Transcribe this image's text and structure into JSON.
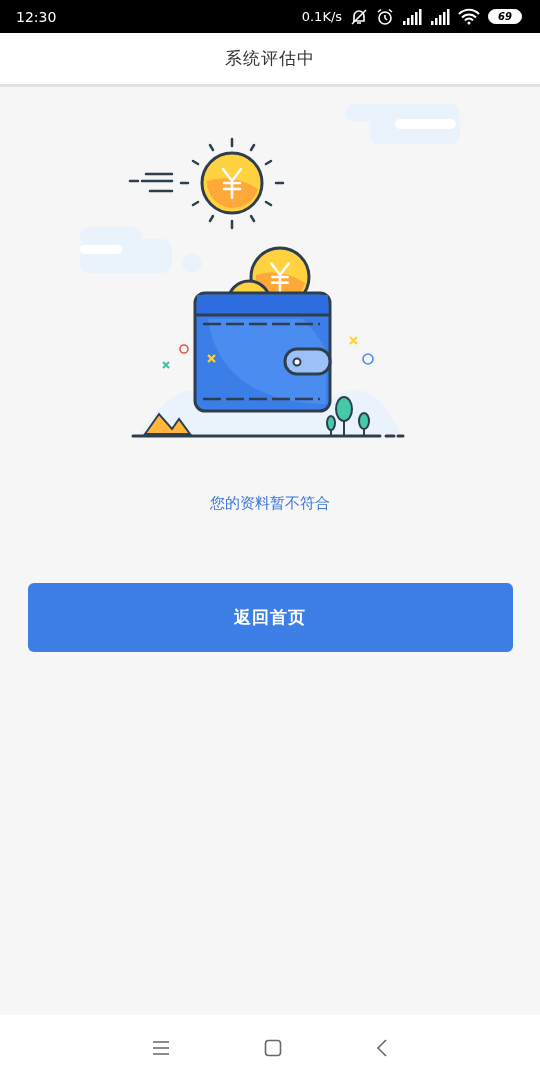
{
  "status_bar": {
    "time": "12:30",
    "net_speed": "0.1K/s",
    "battery": "69"
  },
  "header": {
    "title": "系统评估中"
  },
  "message": "您的资料暂不符合",
  "button": {
    "label": "返回首页"
  }
}
